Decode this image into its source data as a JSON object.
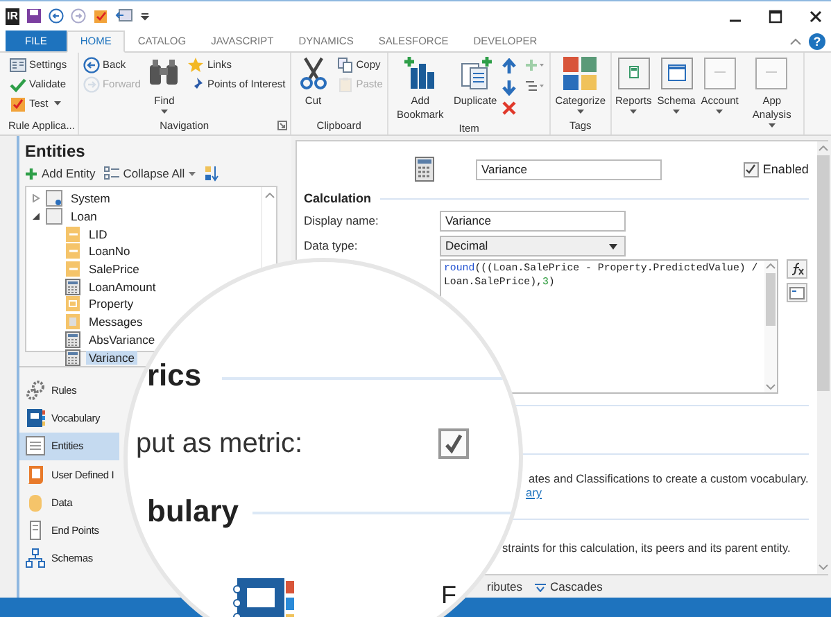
{
  "app_logo": "IR",
  "tabs": [
    {
      "label": "FILE",
      "kind": "file",
      "selected": false
    },
    {
      "label": "HOME",
      "kind": "tab",
      "selected": true
    },
    {
      "label": "CATALOG",
      "kind": "tab",
      "selected": false
    },
    {
      "label": "JAVASCRIPT",
      "kind": "tab",
      "selected": false
    },
    {
      "label": "DYNAMICS",
      "kind": "tab",
      "selected": false
    },
    {
      "label": "SALESFORCE",
      "kind": "tab",
      "selected": false
    },
    {
      "label": "DEVELOPER",
      "kind": "tab",
      "selected": false
    }
  ],
  "help_label": "?",
  "ribbon": {
    "groups": [
      {
        "label": "Rule Applica...",
        "launcher": false,
        "columns": [
          {
            "kind": "small",
            "buttons": [
              {
                "label": "Settings",
                "disabled": false,
                "dropdown": false
              },
              {
                "label": "Validate",
                "disabled": false,
                "dropdown": false
              },
              {
                "label": "Test",
                "disabled": false,
                "dropdown": true
              }
            ]
          }
        ]
      },
      {
        "label": "Navigation",
        "launcher": true,
        "columns": [
          {
            "kind": "small",
            "buttons": [
              {
                "label": "Back",
                "disabled": false,
                "dropdown": false
              },
              {
                "label": "Forward",
                "disabled": true,
                "dropdown": false
              }
            ]
          },
          {
            "kind": "large",
            "buttons": [
              {
                "label": "Find",
                "disabled": false,
                "dropdown": true
              }
            ]
          },
          {
            "kind": "small",
            "buttons": [
              {
                "label": "Links",
                "disabled": false,
                "dropdown": false
              },
              {
                "label": "Points of Interest",
                "disabled": false,
                "dropdown": false
              }
            ]
          }
        ]
      },
      {
        "label": "Clipboard",
        "launcher": false,
        "columns": [
          {
            "kind": "large",
            "buttons": [
              {
                "label": "Cut",
                "disabled": false,
                "dropdown": false
              }
            ]
          },
          {
            "kind": "small",
            "buttons": [
              {
                "label": "Copy",
                "disabled": false,
                "dropdown": false
              },
              {
                "label": "Paste",
                "disabled": true,
                "dropdown": false
              }
            ]
          }
        ]
      },
      {
        "label": "Item",
        "launcher": false,
        "columns": [
          {
            "kind": "large",
            "buttons": [
              {
                "label": "Add Bookmark",
                "disabled": false,
                "dropdown": false
              }
            ]
          },
          {
            "kind": "large",
            "buttons": [
              {
                "label": "Duplicate",
                "disabled": false,
                "dropdown": false
              }
            ]
          },
          {
            "kind": "arrows"
          }
        ]
      },
      {
        "label": "Tags",
        "launcher": false,
        "columns": [
          {
            "kind": "large",
            "buttons": [
              {
                "label": "Categorize",
                "disabled": false,
                "dropdown": true
              }
            ]
          }
        ]
      },
      {
        "columns": [
          {
            "kind": "large",
            "buttons": [
              {
                "label": "Reports",
                "disabled": false,
                "dropdown": true
              }
            ]
          },
          {
            "kind": "large",
            "buttons": [
              {
                "label": "Schema",
                "disabled": false,
                "dropdown": true
              }
            ]
          },
          {
            "kind": "large",
            "buttons": [
              {
                "label": "Account",
                "disabled": false,
                "dropdown": true
              }
            ]
          },
          {
            "kind": "large",
            "buttons": [
              {
                "label": "App Analysis",
                "disabled": false,
                "dropdown": true
              }
            ]
          }
        ]
      }
    ]
  },
  "entities": {
    "title": "Entities",
    "toolbar": [
      {
        "label": "Add Entity",
        "dropdown": false
      },
      {
        "label": "Collapse All",
        "dropdown": true
      }
    ],
    "tree": [
      {
        "label": "System",
        "kind": "entity",
        "expanded": false,
        "selected": false
      },
      {
        "label": "Loan",
        "kind": "entity",
        "expanded": true,
        "selected": false,
        "children": [
          {
            "label": "LID",
            "kind": "field",
            "selected": false
          },
          {
            "label": "LoanNo",
            "kind": "field",
            "selected": false
          },
          {
            "label": "SalePrice",
            "kind": "field",
            "selected": false
          },
          {
            "label": "LoanAmount",
            "kind": "calc",
            "selected": false
          },
          {
            "label": "Property",
            "kind": "child",
            "selected": false
          },
          {
            "label": "Messages",
            "kind": "messages",
            "selected": false
          },
          {
            "label": "AbsVariance",
            "kind": "calc",
            "selected": false
          },
          {
            "label": "Variance",
            "kind": "calc",
            "selected": true
          }
        ]
      }
    ]
  },
  "nav": [
    {
      "label": "Rules",
      "selected": false
    },
    {
      "label": "Vocabulary",
      "selected": false
    },
    {
      "label": "Entities",
      "selected": true
    },
    {
      "label": "User Defined I",
      "selected": false
    },
    {
      "label": "Data",
      "selected": false
    },
    {
      "label": "End Points",
      "selected": false
    },
    {
      "label": "Schemas",
      "selected": false
    }
  ],
  "editor": {
    "name": "Variance",
    "enabled": true,
    "enabled_label": "Enabled",
    "heading": "Calculation",
    "fields": [
      {
        "label": "Display name:",
        "kind": "text",
        "value": "Variance"
      },
      {
        "label": "Data type:",
        "kind": "select",
        "value": "Decimal"
      }
    ],
    "expression": [
      {
        "text": "round",
        "kind": "keyword"
      },
      {
        "text": "(((Loan.SalePrice - Property.PredictedValue) /\nLoan.SalePrice),",
        "kind": "plain"
      },
      {
        "text": "3",
        "kind": "number"
      },
      {
        "text": ")",
        "kind": "plain"
      }
    ],
    "vocabulary_text": "ates and Classifications to create a custom vocabulary.",
    "vocabulary_link": "ary",
    "constraints_text": "straints for this calculation, its peers and its parent entity.",
    "bottom_tabs": [
      {
        "label": "ributes"
      },
      {
        "label": "Cascades"
      }
    ]
  },
  "magnifier": {
    "heading_1": "rics",
    "field_label": "put as metric:",
    "checked": true,
    "heading_2": "bulary",
    "bottom_letter": "F"
  }
}
